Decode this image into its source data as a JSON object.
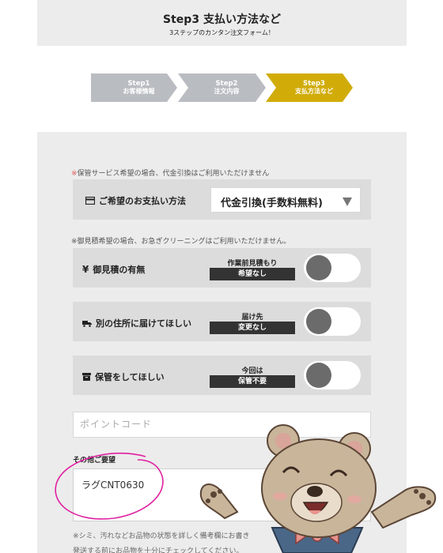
{
  "header": {
    "title": "Step3 支払い方法など",
    "subtitle": "3ステップのカンタン注文フォーム！"
  },
  "steps": [
    {
      "num": "Step1",
      "label": "お客様情報",
      "active": false
    },
    {
      "num": "Step2",
      "label": "注文内容",
      "active": false
    },
    {
      "num": "Step3",
      "label": "支払方法など",
      "active": true
    }
  ],
  "notices": {
    "storage_mark": "※",
    "storage": "保管サービス希望の場合、代金引換はご利用いただけません",
    "estimate": "※御見積希望の場合、お急ぎクリーニングはご利用いただけません。"
  },
  "payment": {
    "icon": "card-icon",
    "label": "ご希望のお支払い方法",
    "selected": "代金引換(手数料無料)"
  },
  "options": [
    {
      "icon": "yen-icon",
      "label": "御見積の有無",
      "caption": "作業前見積もり",
      "state": "希望なし"
    },
    {
      "icon": "truck-icon",
      "label": "別の住所に届けてほしい",
      "caption": "届け先",
      "state": "変更なし"
    },
    {
      "icon": "box-icon",
      "label": "保管をしてほしい",
      "caption": "今回は",
      "state": "保管不要"
    }
  ],
  "point_code": {
    "placeholder": "ポイントコード"
  },
  "other": {
    "label": "その他ご要望",
    "value": "ラグCNT0630"
  },
  "bottom_notes": [
    "※シミ、汚れなどお品物の状態を詳しく備考欄にお書き",
    "発送する前にお品物を十分にチェックしてください。"
  ],
  "colors": {
    "accent": "#d1ac09",
    "inactive_step": "#b9bdc2",
    "annotation": "#e020a0"
  }
}
